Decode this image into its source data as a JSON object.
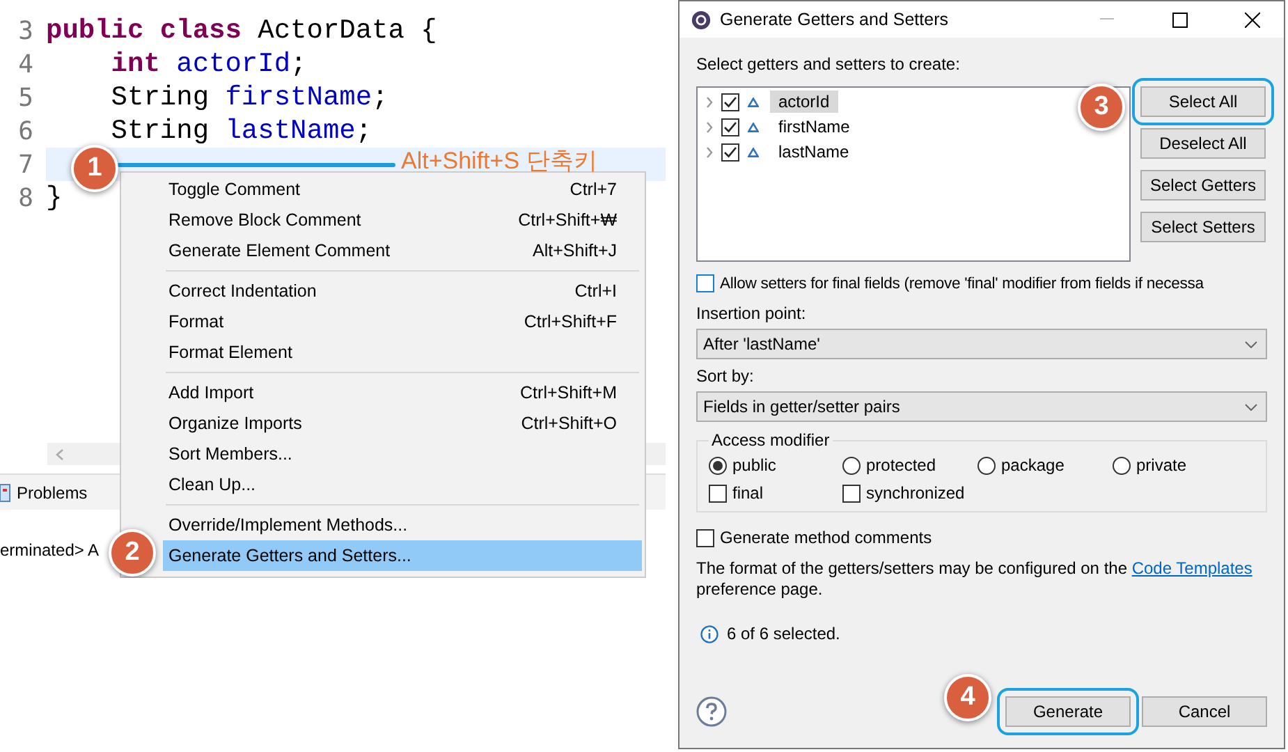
{
  "editor": {
    "lines": [
      {
        "number": "3",
        "current": false,
        "tokens": [
          {
            "kind": "keyword",
            "text": "public class"
          },
          {
            "kind": "plain",
            "text": " ActorData {"
          }
        ]
      },
      {
        "number": "4",
        "current": false,
        "tokens": [
          {
            "kind": "keyword",
            "text": "    int"
          },
          {
            "kind": "field",
            "text": " actorId"
          },
          {
            "kind": "plain",
            "text": ";"
          }
        ]
      },
      {
        "number": "5",
        "current": false,
        "tokens": [
          {
            "kind": "plain",
            "text": "    String "
          },
          {
            "kind": "field",
            "text": "firstName"
          },
          {
            "kind": "plain",
            "text": ";"
          }
        ]
      },
      {
        "number": "6",
        "current": false,
        "tokens": [
          {
            "kind": "plain",
            "text": "    String "
          },
          {
            "kind": "field",
            "text": "lastName"
          },
          {
            "kind": "plain",
            "text": ";"
          }
        ]
      },
      {
        "number": "7",
        "current": true
      },
      {
        "number": "8",
        "current": false,
        "tokens": [
          {
            "kind": "plain",
            "text": "}"
          }
        ]
      }
    ]
  },
  "bottom_panel": {
    "tabs": [
      "Problems"
    ],
    "console": "erminated> A"
  },
  "context_menu": {
    "groups": [
      [
        {
          "label": "Toggle Comment",
          "shortcut": "Ctrl+7",
          "selected": false
        },
        {
          "label": "Remove Block Comment",
          "shortcut": "Ctrl+Shift+₩",
          "selected": false
        },
        {
          "label": "Generate Element Comment",
          "shortcut": "Alt+Shift+J",
          "selected": false
        }
      ],
      [
        {
          "label": "Correct Indentation",
          "shortcut": "Ctrl+I",
          "selected": false
        },
        {
          "label": "Format",
          "shortcut": "Ctrl+Shift+F",
          "selected": false
        },
        {
          "label": "Format Element",
          "selected": false
        }
      ],
      [
        {
          "label": "Add Import",
          "shortcut": "Ctrl+Shift+M",
          "selected": false
        },
        {
          "label": "Organize Imports",
          "shortcut": "Ctrl+Shift+O",
          "selected": false
        },
        {
          "label": "Sort Members...",
          "selected": false
        },
        {
          "label": "Clean Up...",
          "selected": false
        }
      ],
      [
        {
          "label": "Override/Implement Methods...",
          "selected": false
        },
        {
          "label": "Generate Getters and Setters...",
          "selected": true
        }
      ]
    ]
  },
  "annotations": {
    "callouts": [
      "1",
      "2",
      "3",
      "4"
    ],
    "note": "Alt+Shift+S 단축키"
  },
  "dialog": {
    "title": "Generate Getters and Setters",
    "prompt": "Select getters and setters to create:",
    "fields": [
      {
        "label": "actorId",
        "checked": true,
        "selected": true
      },
      {
        "label": "firstName",
        "checked": true,
        "selected": false
      },
      {
        "label": "lastName",
        "checked": true,
        "selected": false
      }
    ],
    "side_buttons": [
      {
        "label": "Select All",
        "highlighted": true
      },
      {
        "label": "Deselect All",
        "highlighted": false
      },
      {
        "label": "Select Getters",
        "highlighted": false
      },
      {
        "label": "Select Setters",
        "highlighted": false
      }
    ],
    "allow_final": {
      "label": "Allow setters for final fields (remove 'final' modifier from fields if necessa",
      "checked": false
    },
    "insertion_point": {
      "label": "Insertion point:",
      "value": "After 'lastName'"
    },
    "sort_by": {
      "label": "Sort by:",
      "value": "Fields in getter/setter pairs"
    },
    "access_modifier": {
      "title": "Access modifier",
      "options": [
        {
          "label": "public",
          "selected": true
        },
        {
          "label": "protected",
          "selected": false
        },
        {
          "label": "package",
          "selected": false
        },
        {
          "label": "private",
          "selected": false
        }
      ],
      "flags": [
        {
          "label": "final",
          "checked": false
        },
        {
          "label": "synchronized",
          "checked": false
        }
      ]
    },
    "method_comments": {
      "label": "Generate method comments",
      "checked": false
    },
    "info": {
      "before": "The format of the getters/setters may be configured on the ",
      "link": "Code Templates",
      "after": "preference page."
    },
    "status": "6 of 6 selected.",
    "footer_buttons": [
      {
        "label": "Generate",
        "highlighted": true
      },
      {
        "label": "Cancel",
        "highlighted": false
      }
    ]
  }
}
